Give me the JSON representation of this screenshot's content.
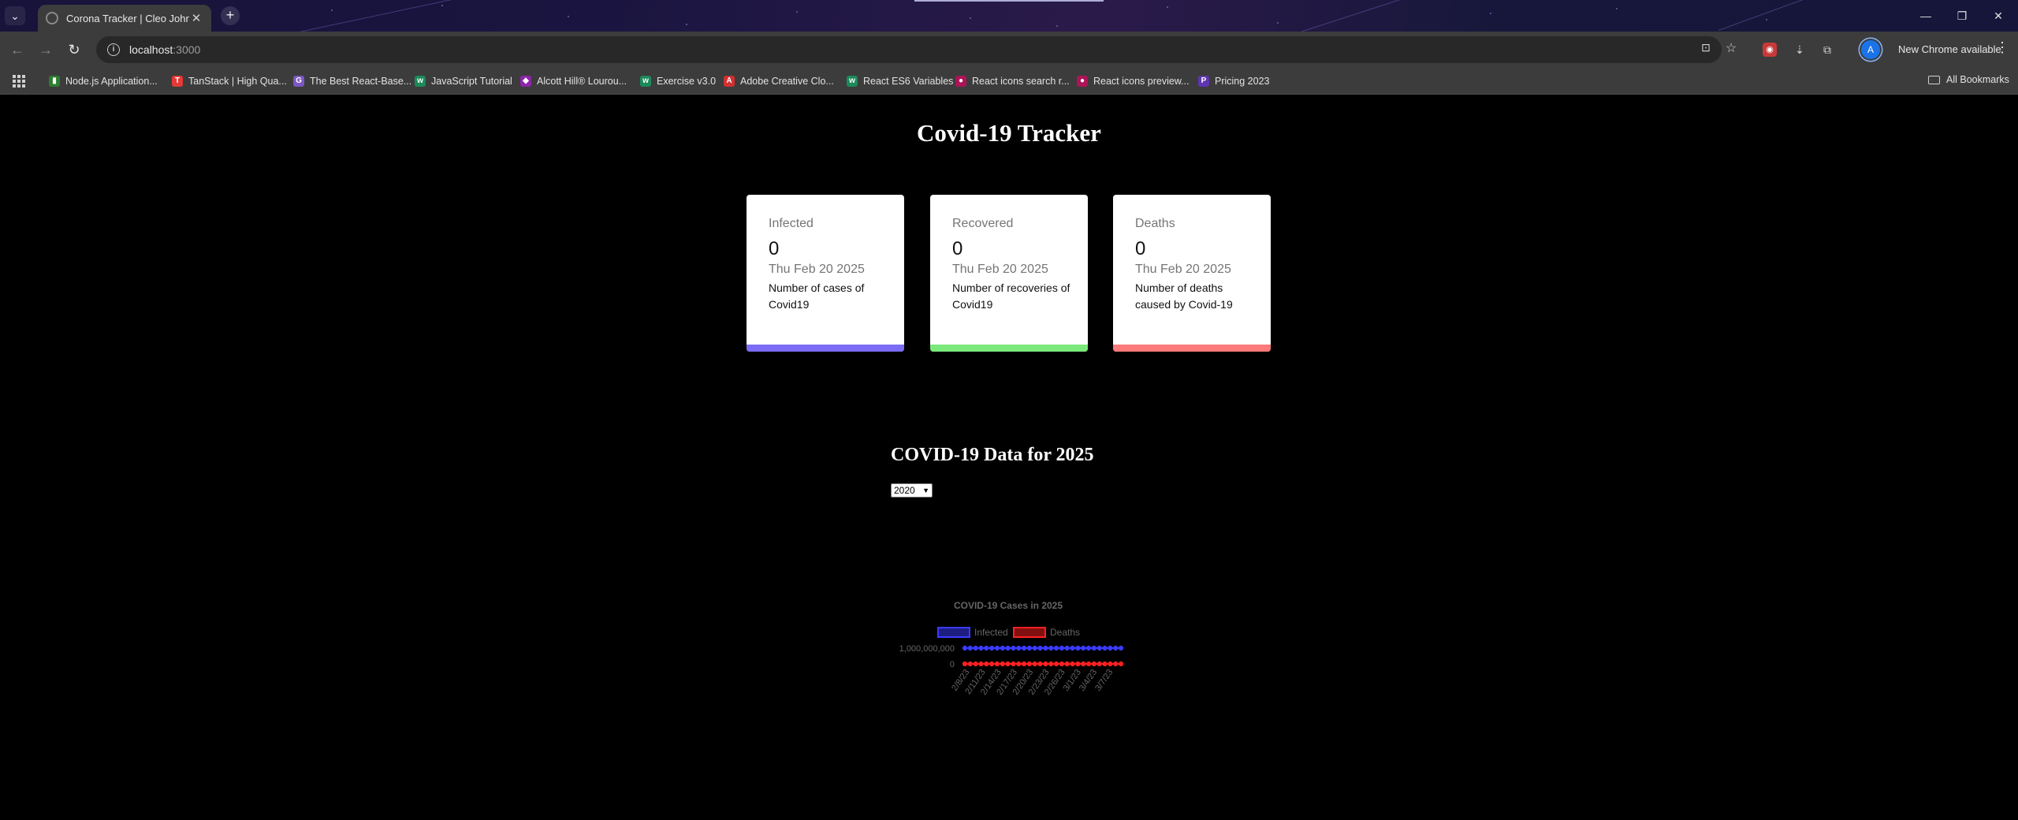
{
  "browser": {
    "tab_title": "Corona Tracker | Cleo Johnson",
    "url_host": "localhost",
    "url_port": ":3000",
    "update_chip": "New Chrome available",
    "profile_initial": "A",
    "bookmarks": [
      {
        "label": "Node.js Application...",
        "color": "#2e7d32",
        "glyph": "▮"
      },
      {
        "label": "TanStack | High Qua...",
        "color": "#e53935",
        "glyph": "T"
      },
      {
        "label": "The Best React-Base...",
        "color": "#7e57c2",
        "glyph": "G"
      },
      {
        "label": "JavaScript Tutorial",
        "color": "#1b8a5a",
        "glyph": "w"
      },
      {
        "label": "Alcott Hill® Lourou...",
        "color": "#8e24aa",
        "glyph": "◆"
      },
      {
        "label": "Exercise v3.0",
        "color": "#1b8a5a",
        "glyph": "w"
      },
      {
        "label": "Adobe Creative Clo...",
        "color": "#d32f2f",
        "glyph": "A"
      },
      {
        "label": "React ES6 Variables",
        "color": "#1b8a5a",
        "glyph": "w"
      },
      {
        "label": "React icons search r...",
        "color": "#ad1457",
        "glyph": "●"
      },
      {
        "label": "React icons preview...",
        "color": "#ad1457",
        "glyph": "●"
      },
      {
        "label": "Pricing 2023",
        "color": "#5e35b1",
        "glyph": "P"
      }
    ],
    "all_bookmarks": "All Bookmarks"
  },
  "page": {
    "title": "Covid-19 Tracker",
    "cards": [
      {
        "label": "Infected",
        "value": "0",
        "date": "Thu Feb 20 2025",
        "description": "Number of cases of Covid19",
        "color": "#7b6cf6"
      },
      {
        "label": "Recovered",
        "value": "0",
        "date": "Thu Feb 20 2025",
        "description": "Number of recoveries of Covid19",
        "color": "#7be87b"
      },
      {
        "label": "Deaths",
        "value": "0",
        "date": "Thu Feb 20 2025",
        "description": "Number of deaths caused by Covid-19",
        "color": "#ff7a7a"
      }
    ],
    "data_title": "COVID-19 Data for 2025",
    "year_selected": "2020"
  },
  "chart_data": {
    "type": "line",
    "title": "COVID-19 Cases in 2025",
    "legend_position": "top",
    "ylim": [
      0,
      1000000000
    ],
    "y_ticks": [
      "0",
      "1,000,000,000"
    ],
    "x_tick_labels": [
      "2/8/23",
      "2/11/23",
      "2/14/23",
      "2/17/23",
      "2/20/23",
      "2/23/23",
      "2/26/23",
      "3/1/23",
      "3/4/23",
      "3/7/23"
    ],
    "point_count": 30,
    "series": [
      {
        "name": "Infected",
        "color": "#3b3bff",
        "value": 1000000000
      },
      {
        "name": "Deaths",
        "color": "#ff2020",
        "value": 0
      }
    ]
  }
}
